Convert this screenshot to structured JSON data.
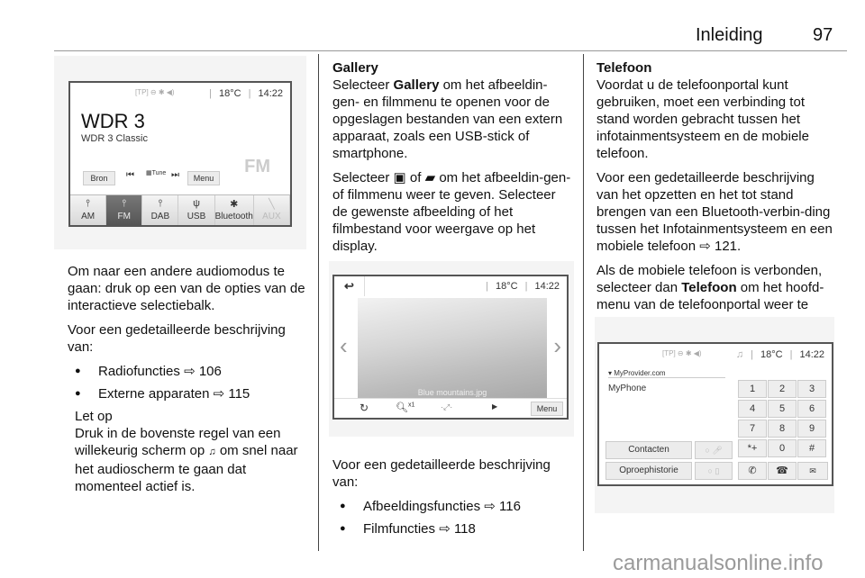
{
  "header": {
    "title": "Inleiding",
    "page": "97"
  },
  "left": {
    "screen": {
      "status_icons": "[TP] ⊖ ✱ ◀)",
      "temp": "18°C",
      "time": "14:22",
      "station": "WDR 3",
      "station_sub": "WDR 3 Classic",
      "source_btn": "Bron",
      "tune": "Tune",
      "menu_btn": "Menu",
      "logo": "FM",
      "tabs": [
        "AM",
        "FM",
        "DAB",
        "USB",
        "Bluetooth",
        "AUX"
      ],
      "active_tab": "FM"
    },
    "p1": "Om naar een andere audiomodus te gaan: druk op een van de opties van de interactieve selectiebalk.",
    "p2": "Voor een gedetailleerde beschrijving van:",
    "bullets": [
      {
        "text": "Radiofuncties",
        "ref": "106"
      },
      {
        "text": "Externe apparaten",
        "ref": "115"
      }
    ],
    "note_title": "Let op",
    "note_a": "Druk in de bovenste regel van een willekeurig scherm op",
    "note_b": "om snel naar het audioscherm te gaan dat momenteel actief is."
  },
  "middle": {
    "heading": "Gallery",
    "p1a": "Selecteer",
    "p1b": "Gallery",
    "p1c": "om het afbeeldin-gen- en filmmenu te openen voor de opgeslagen bestanden van een extern apparaat, zoals een USB-stick of smartphone.",
    "p2a": "Selecteer",
    "p2of": "of",
    "p2b": "om het afbeeldin-gen- of filmmenu weer te geven. Selecteer de gewenste afbeelding of het filmbestand voor weergave op het display.",
    "screen": {
      "temp": "18°C",
      "time": "14:22",
      "caption": "Blue mountains.jpg",
      "zoom": "x1",
      "menu_btn": "Menu"
    },
    "p3": "Voor een gedetailleerde beschrijving van:",
    "bullets": [
      {
        "text": "Afbeeldingsfuncties",
        "ref": "116"
      },
      {
        "text": "Filmfuncties",
        "ref": "118"
      }
    ]
  },
  "right": {
    "heading": "Telefoon",
    "p1": "Voordat u de telefoonportal kunt gebruiken, moet een verbinding tot stand worden gebracht tussen het infotainmentsysteem en de mobiele telefoon.",
    "p2a": "Voor een gedetailleerde beschrijving van het opzetten en het tot stand brengen van een Bluetooth-verbin-ding tussen het Infotainmentsysteem en een mobiele telefoon",
    "p2ref": "121",
    "p3a": "Als de mobiele telefoon is verbonden, selecteer dan",
    "p3b": "Telefoon",
    "p3c": "om het hoofd-menu van de telefoonportal weer te geven.",
    "screen": {
      "status_icons": "[TP] ⊖ ✱ ◀)",
      "temp": "18°C",
      "time": "14:22",
      "provider": "MyProvider.com",
      "phone": "MyPhone",
      "contacts_btn": "Contacten",
      "history_btn": "Oproephistorie",
      "keys": [
        "1",
        "2",
        "3",
        "4",
        "5",
        "6",
        "7",
        "8",
        "9",
        "*+",
        "0",
        "#"
      ]
    }
  },
  "watermark": "carmanualsonline.info"
}
